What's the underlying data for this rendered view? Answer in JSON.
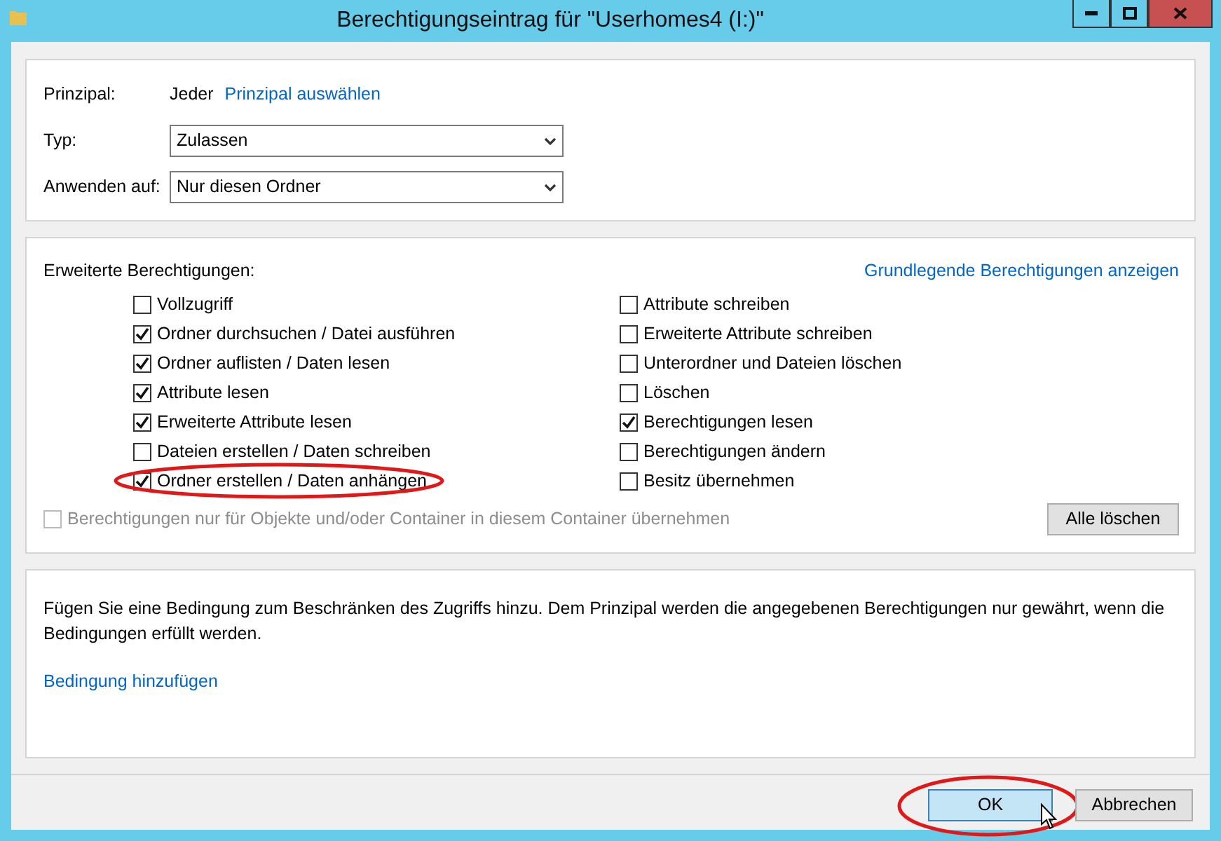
{
  "window": {
    "title": "Berechtigungseintrag für \"Userhomes4 (I:)\""
  },
  "principal": {
    "label": "Prinzipal:",
    "value": "Jeder",
    "link": "Prinzipal auswählen"
  },
  "fields": [
    {
      "label": "Typ:",
      "value": "Zulassen"
    },
    {
      "label": "Anwenden auf:",
      "value": "Nur diesen Ordner"
    }
  ],
  "permissions": {
    "heading": "Erweiterte Berechtigungen:",
    "link": "Grundlegende Berechtigungen anzeigen",
    "columns": [
      [
        {
          "label": "Vollzugriff",
          "checked": false,
          "highlighted": false
        },
        {
          "label": "Ordner durchsuchen / Datei ausführen",
          "checked": true,
          "highlighted": false
        },
        {
          "label": "Ordner auflisten / Daten lesen",
          "checked": true,
          "highlighted": false
        },
        {
          "label": "Attribute lesen",
          "checked": true,
          "highlighted": false
        },
        {
          "label": "Erweiterte Attribute lesen",
          "checked": true,
          "highlighted": false
        },
        {
          "label": "Dateien erstellen / Daten schreiben",
          "checked": false,
          "highlighted": false
        },
        {
          "label": "Ordner erstellen / Daten anhängen",
          "checked": true,
          "highlighted": true
        }
      ],
      [
        {
          "label": "Attribute schreiben",
          "checked": false,
          "highlighted": false
        },
        {
          "label": "Erweiterte Attribute schreiben",
          "checked": false,
          "highlighted": false
        },
        {
          "label": "Unterordner und Dateien löschen",
          "checked": false,
          "highlighted": false
        },
        {
          "label": "Löschen",
          "checked": false,
          "highlighted": false
        },
        {
          "label": "Berechtigungen lesen",
          "checked": true,
          "highlighted": false
        },
        {
          "label": "Berechtigungen ändern",
          "checked": false,
          "highlighted": false
        },
        {
          "label": "Besitz übernehmen",
          "checked": false,
          "highlighted": false
        }
      ]
    ],
    "inherit": {
      "label": "Berechtigungen nur für Objekte und/oder Container in diesem Container übernehmen",
      "checked": false,
      "disabled": true
    },
    "clear_button": "Alle löschen"
  },
  "condition": {
    "text": "Fügen Sie eine Bedingung zum Beschränken des Zugriffs hinzu. Dem Prinzipal werden die angegebenen Berechtigungen nur gewährt, wenn die Bedingungen erfüllt werden.",
    "link": "Bedingung hinzufügen"
  },
  "buttons": [
    {
      "label": "OK",
      "highlighted": true
    },
    {
      "label": "Abbrechen",
      "highlighted": false
    }
  ]
}
